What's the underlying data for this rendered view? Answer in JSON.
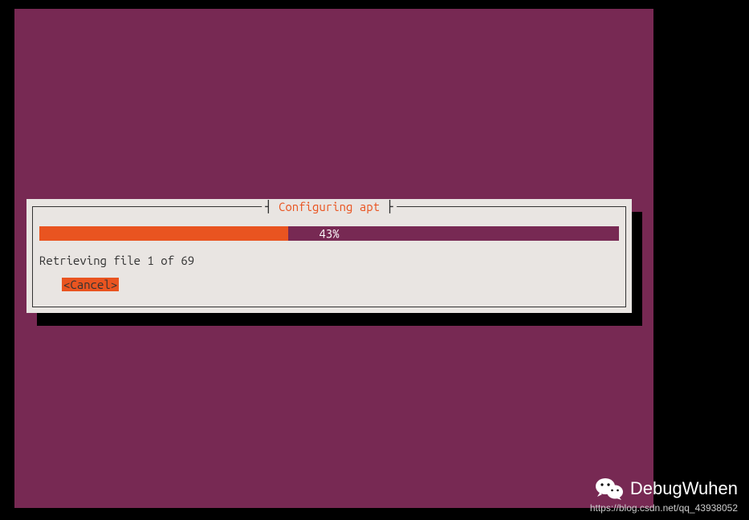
{
  "dialog": {
    "title": "Configuring apt",
    "progress_percent": 43,
    "progress_label": "43%",
    "status": "Retrieving file 1 of 69",
    "cancel_label": "<Cancel>"
  },
  "watermark": {
    "name": "DebugWuhen",
    "url": "https://blog.csdn.net/qq_43938052"
  },
  "colors": {
    "terminal_bg": "#772953",
    "accent": "#e95420",
    "dialog_bg": "#e9e5e2"
  }
}
